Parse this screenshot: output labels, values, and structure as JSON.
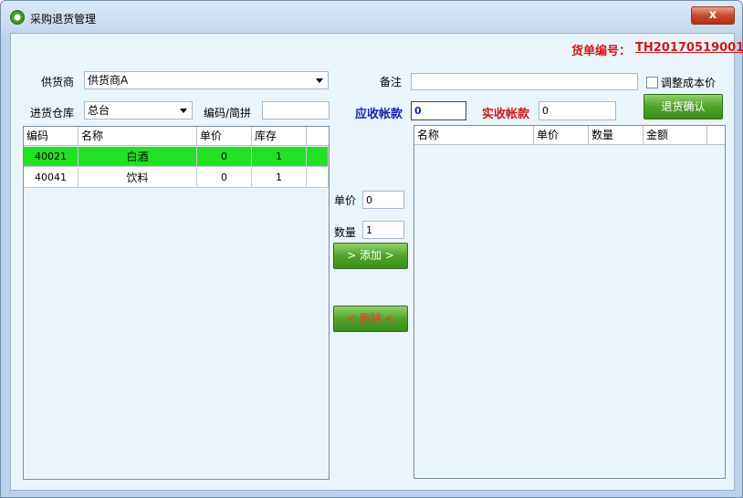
{
  "window": {
    "title": "采购退货管理",
    "close_label": "x"
  },
  "header": {
    "order_label": "货单编号：",
    "order_no": "TH20170519001"
  },
  "supplier": {
    "label": "供货商",
    "value": "供货商A"
  },
  "warehouse": {
    "label": "进货仓库",
    "value": "总台"
  },
  "code_search": {
    "label": "编码/简拼",
    "value": ""
  },
  "remark": {
    "label": "备注",
    "value": ""
  },
  "adjust_cost": {
    "label": "调整成本价",
    "checked": false
  },
  "receivable": {
    "label": "应收帐款",
    "value": "0"
  },
  "received": {
    "label": "实收帐款",
    "value": "0"
  },
  "confirm_button": "退货确认",
  "price": {
    "label": "单价",
    "value": "0"
  },
  "qty": {
    "label": "数量",
    "value": "1"
  },
  "add_button": "> 添加 >",
  "delete_button": "< 删除 <",
  "left_table": {
    "columns": [
      "编码",
      "名称",
      "单价",
      "库存"
    ],
    "rows": [
      {
        "code": "40021",
        "name": "白酒",
        "price": "0",
        "stock": "1",
        "selected": true
      },
      {
        "code": "40041",
        "name": "饮料",
        "price": "0",
        "stock": "1",
        "selected": false
      }
    ]
  },
  "right_table": {
    "columns": [
      "名称",
      "单价",
      "数量",
      "金额"
    ]
  },
  "colors": {
    "selected_row": "#22e022",
    "accent_red": "#d21818",
    "accent_blue": "#1b24b4",
    "button_green": "#4fa428"
  }
}
